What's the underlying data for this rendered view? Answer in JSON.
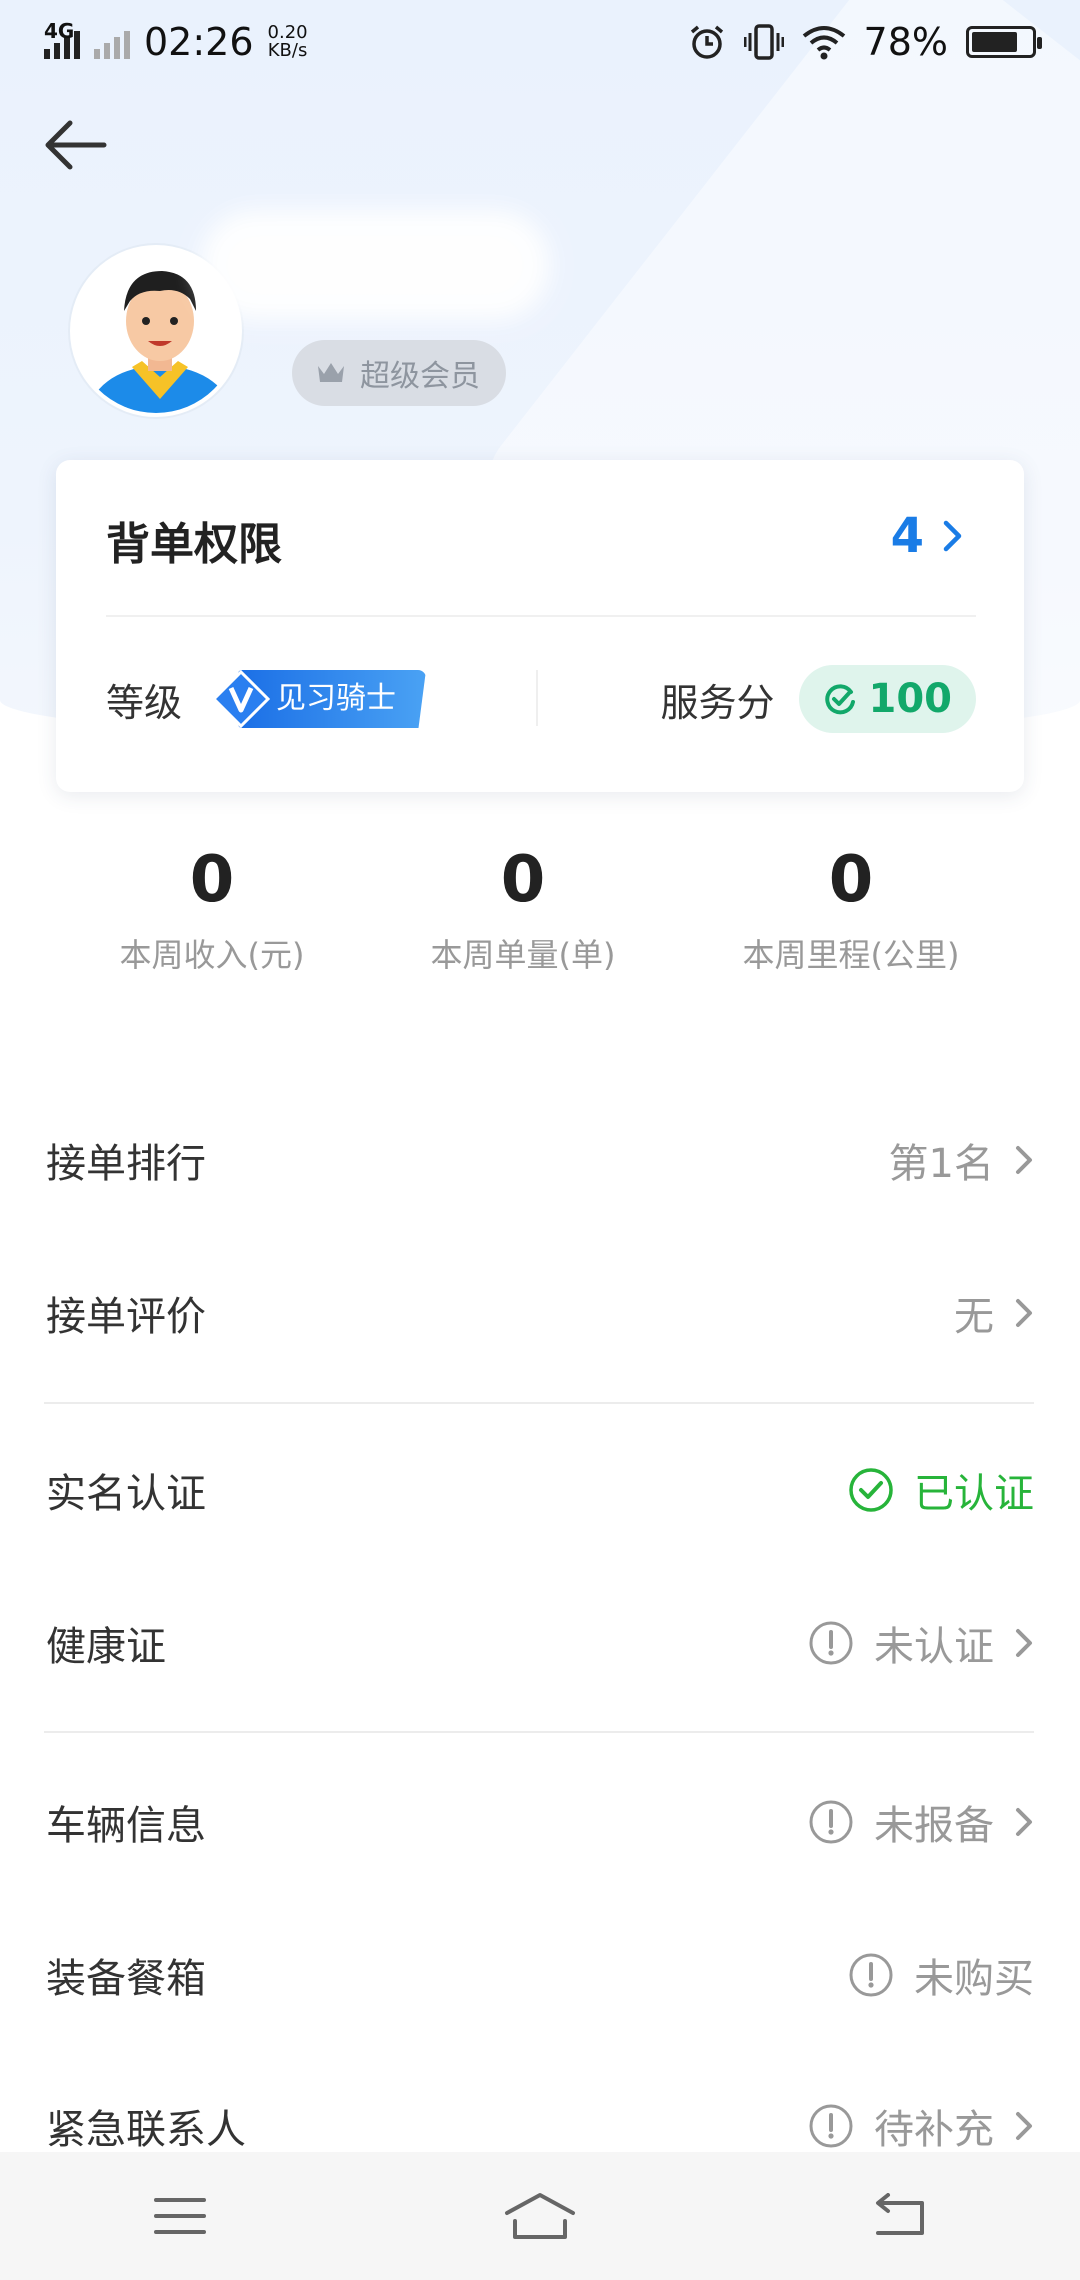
{
  "status_bar": {
    "network": "4G",
    "time": "02:26",
    "speed_value": "0.20",
    "speed_unit": "KB/s",
    "battery_text": "78%",
    "battery_level": 0.78,
    "icons": [
      "alarm-icon",
      "vibrate-icon",
      "wifi-icon",
      "battery-icon"
    ]
  },
  "header": {
    "back_icon": "arrow-left-icon",
    "member_badge": "超级会员",
    "member_icon": "crown-icon"
  },
  "card": {
    "title": "背单权限",
    "count": "4",
    "level_label": "等级",
    "level_badge": "见习骑士",
    "score_label": "服务分",
    "score_value": "100"
  },
  "stats": [
    {
      "value": "0",
      "label": "本周收入(元)"
    },
    {
      "value": "0",
      "label": "本周单量(单)"
    },
    {
      "value": "0",
      "label": "本周里程(公里)"
    }
  ],
  "list": {
    "rank": {
      "label": "接单排行",
      "value": "第1名"
    },
    "review": {
      "label": "接单评价",
      "value": "无"
    },
    "realname": {
      "label": "实名认证",
      "value": "已认证"
    },
    "health": {
      "label": "健康证",
      "value": "未认证"
    },
    "vehicle": {
      "label": "车辆信息",
      "value": "未报备"
    },
    "box": {
      "label": "装备餐箱",
      "value": "未购买"
    },
    "emergency": {
      "label": "紧急联系人",
      "value": "待补充"
    }
  },
  "colors": {
    "accent_blue": "#1a7ce6",
    "success_green": "#27b43a",
    "score_green": "#12a86a",
    "muted_text": "#999999"
  },
  "nav_bar": {
    "icons": [
      "menu-icon",
      "home-icon",
      "back-icon"
    ]
  }
}
